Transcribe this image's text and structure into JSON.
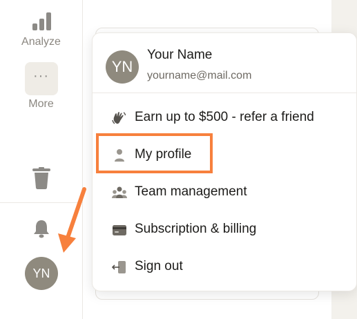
{
  "sidebar": {
    "analyze_label": "Analyze",
    "more_label": "More",
    "more_glyph": "···",
    "avatar_initials": "YN"
  },
  "menu": {
    "user_name": "Your Name",
    "user_email": "yourname@mail.com",
    "avatar_initials": "YN",
    "items": [
      {
        "label": "Earn up to $500 - refer a friend",
        "icon": "hand-wave-icon"
      },
      {
        "label": "My profile",
        "icon": "user-icon",
        "highlighted": true
      },
      {
        "label": "Team management",
        "icon": "team-icon"
      },
      {
        "label": "Subscription & billing",
        "icon": "credit-card-icon"
      },
      {
        "label": "Sign out",
        "icon": "sign-out-icon"
      }
    ]
  },
  "colors": {
    "accent_annotation": "#f7803d",
    "avatar_bg": "#8f8a7e",
    "icon_gray": "#8c8a86",
    "text_primary": "#1c1b19",
    "text_secondary": "#6e6a63"
  }
}
